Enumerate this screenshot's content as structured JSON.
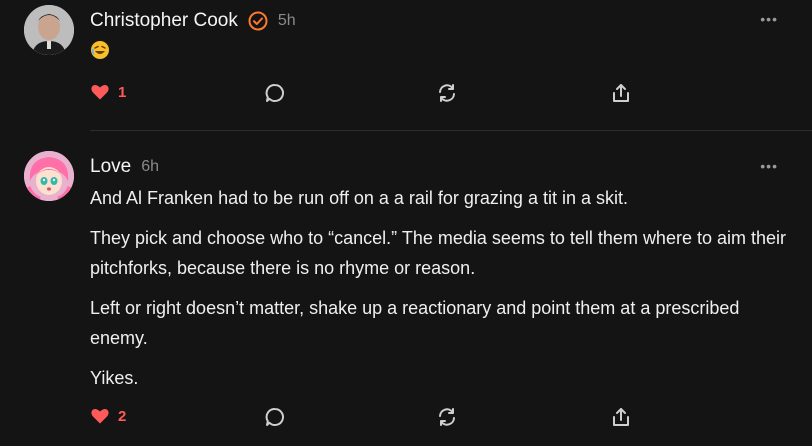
{
  "posts": [
    {
      "author": "Christopher Cook",
      "time": "5h",
      "verified": true,
      "emoji": "🤣",
      "paragraphs": [],
      "like_count": "1"
    },
    {
      "author": "Love",
      "time": "6h",
      "verified": false,
      "paragraphs": [
        "And Al Franken had to be run off on a a rail for grazing a tit in a skit.",
        "They pick and choose who to “cancel.” The media seems to tell them where to aim their pitchforks, because there is no rhyme or reason.",
        "Left or right doesn’t matter, shake up a reactionary and point them at a prescribed enemy.",
        "Yikes."
      ],
      "like_count": "2"
    }
  ],
  "icons": {
    "more": "more-icon",
    "like": "heart-icon",
    "comment": "comment-icon",
    "restack": "restack-icon",
    "share": "share-icon"
  },
  "colors": {
    "background": "#141414",
    "like": "#ff5a5a",
    "verified": "#ff7a2e",
    "muted": "#8a8a8a"
  }
}
